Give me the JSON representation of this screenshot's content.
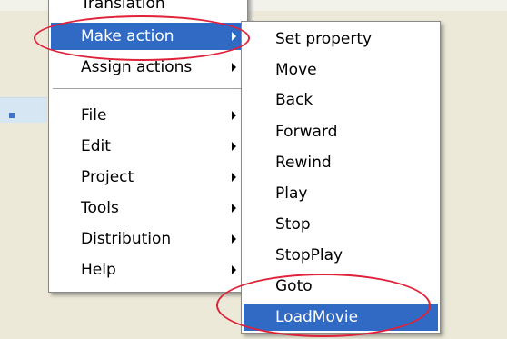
{
  "main_menu": {
    "items": [
      {
        "label": "Translation",
        "submenu": false
      },
      {
        "label": "Make action",
        "submenu": true,
        "selected": true
      },
      {
        "label": "Assign actions",
        "submenu": true
      },
      {
        "label": "File",
        "submenu": true
      },
      {
        "label": "Edit",
        "submenu": true
      },
      {
        "label": "Project",
        "submenu": true
      },
      {
        "label": "Tools",
        "submenu": true
      },
      {
        "label": "Distribution",
        "submenu": true
      },
      {
        "label": "Help",
        "submenu": true
      }
    ]
  },
  "sub_menu": {
    "items": [
      {
        "label": "Set property"
      },
      {
        "label": "Move"
      },
      {
        "label": "Back"
      },
      {
        "label": "Forward"
      },
      {
        "label": "Rewind"
      },
      {
        "label": "Play"
      },
      {
        "label": "Stop"
      },
      {
        "label": "StopPlay"
      },
      {
        "label": "Goto"
      },
      {
        "label": "LoadMovie",
        "selected": true
      }
    ]
  },
  "colors": {
    "selection": "#316ac5",
    "highlight_ring": "#e0213a",
    "background": "#ece9d8"
  }
}
